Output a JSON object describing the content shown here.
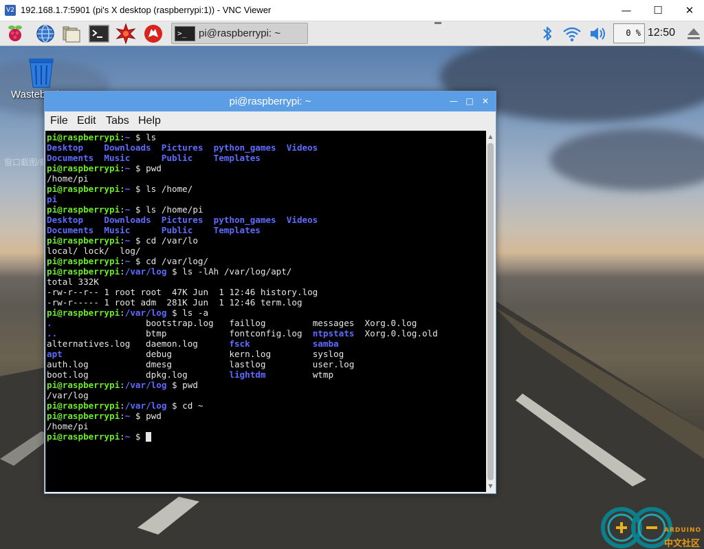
{
  "vnc": {
    "icon_text": "V2",
    "title": "192.168.1.7:5901 (pi's X desktop (raspberrypi:1)) - VNC Viewer",
    "minimize": "—",
    "maximize": "☐",
    "close": "✕"
  },
  "taskbar": {
    "launchers": [
      "raspberry-menu-icon",
      "web-browser-icon",
      "file-manager-icon",
      "terminal-icon",
      "mathematica-icon",
      "wolfram-icon"
    ],
    "task_button_label": "pi@raspberrypi: ~",
    "task_button_glyph": ">_",
    "cpu_label": "0 %",
    "clock": "12:50",
    "tray": [
      "bluetooth-icon",
      "wifi-icon",
      "volume-icon"
    ]
  },
  "desktop": {
    "trash_label": "Wastebasket",
    "ghost_text": "窗口截图/截"
  },
  "terminal": {
    "title": "pi@raspberrypi: ~",
    "menu": [
      "File",
      "Edit",
      "Tabs",
      "Help"
    ],
    "lines": [
      [
        [
          "g",
          "pi@raspberrypi"
        ],
        [
          "w",
          ":"
        ],
        [
          "b",
          "~"
        ],
        [
          "w",
          " $ ls"
        ]
      ],
      [
        [
          "b",
          "Desktop    Downloads  Pictures  python_games  Videos"
        ]
      ],
      [
        [
          "b",
          "Documents  Music      Public    Templates"
        ]
      ],
      [
        [
          "g",
          "pi@raspberrypi"
        ],
        [
          "w",
          ":"
        ],
        [
          "b",
          "~"
        ],
        [
          "w",
          " $ pwd"
        ]
      ],
      [
        [
          "w",
          "/home/pi"
        ]
      ],
      [
        [
          "g",
          "pi@raspberrypi"
        ],
        [
          "w",
          ":"
        ],
        [
          "b",
          "~"
        ],
        [
          "w",
          " $ ls /home/"
        ]
      ],
      [
        [
          "b",
          "pi"
        ]
      ],
      [
        [
          "g",
          "pi@raspberrypi"
        ],
        [
          "w",
          ":"
        ],
        [
          "b",
          "~"
        ],
        [
          "w",
          " $ ls /home/pi"
        ]
      ],
      [
        [
          "b",
          "Desktop    Downloads  Pictures  python_games  Videos"
        ]
      ],
      [
        [
          "b",
          "Documents  Music      Public    Templates"
        ]
      ],
      [
        [
          "g",
          "pi@raspberrypi"
        ],
        [
          "w",
          ":"
        ],
        [
          "b",
          "~"
        ],
        [
          "w",
          " $ cd /var/lo"
        ]
      ],
      [
        [
          "w",
          "local/ lock/  log/"
        ]
      ],
      [
        [
          "g",
          "pi@raspberrypi"
        ],
        [
          "w",
          ":"
        ],
        [
          "b",
          "~"
        ],
        [
          "w",
          " $ cd /var/log/"
        ]
      ],
      [
        [
          "g",
          "pi@raspberrypi"
        ],
        [
          "w",
          ":"
        ],
        [
          "b",
          "/var/log"
        ],
        [
          "w",
          " $ ls -lAh /var/log/apt/"
        ]
      ],
      [
        [
          "w",
          "total 332K"
        ]
      ],
      [
        [
          "w",
          "-rw-r--r-- 1 root root  47K Jun  1 12:46 history.log"
        ]
      ],
      [
        [
          "w",
          "-rw-r----- 1 root adm  281K Jun  1 12:46 term.log"
        ]
      ],
      [
        [
          "g",
          "pi@raspberrypi"
        ],
        [
          "w",
          ":"
        ],
        [
          "b",
          "/var/log"
        ],
        [
          "w",
          " $ ls -a"
        ]
      ],
      [
        [
          "b",
          "."
        ],
        [
          "w",
          "                  bootstrap.log   faillog         messages  Xorg.0.log"
        ]
      ],
      [
        [
          "b",
          ".."
        ],
        [
          "w",
          "                 btmp            fontconfig.log  "
        ],
        [
          "b",
          "ntpstats"
        ],
        [
          "w",
          "  Xorg.0.log.old"
        ]
      ],
      [
        [
          "w",
          "alternatives.log   daemon.log      "
        ],
        [
          "b",
          "fsck"
        ],
        [
          "w",
          "            "
        ],
        [
          "b",
          "samba"
        ]
      ],
      [
        [
          "b",
          "apt"
        ],
        [
          "w",
          "                debug           kern.log        syslog"
        ]
      ],
      [
        [
          "w",
          "auth.log           dmesg           lastlog         user.log"
        ]
      ],
      [
        [
          "w",
          "boot.log           dpkg.log        "
        ],
        [
          "b",
          "lightdm"
        ],
        [
          "w",
          "         wtmp"
        ]
      ],
      [
        [
          "g",
          "pi@raspberrypi"
        ],
        [
          "w",
          ":"
        ],
        [
          "b",
          "/var/log"
        ],
        [
          "w",
          " $ pwd"
        ]
      ],
      [
        [
          "w",
          "/var/log"
        ]
      ],
      [
        [
          "g",
          "pi@raspberrypi"
        ],
        [
          "w",
          ":"
        ],
        [
          "b",
          "/var/log"
        ],
        [
          "w",
          " $ cd ~"
        ]
      ],
      [
        [
          "g",
          "pi@raspberrypi"
        ],
        [
          "w",
          ":"
        ],
        [
          "b",
          "~"
        ],
        [
          "w",
          " $ pwd"
        ]
      ],
      [
        [
          "w",
          "/home/pi"
        ]
      ],
      [
        [
          "g",
          "pi@raspberrypi"
        ],
        [
          "w",
          ":"
        ],
        [
          "b",
          "~"
        ],
        [
          "w",
          " $ "
        ]
      ]
    ]
  },
  "watermark": {
    "line1": "ARDUINO",
    "line2": "中文社区"
  }
}
